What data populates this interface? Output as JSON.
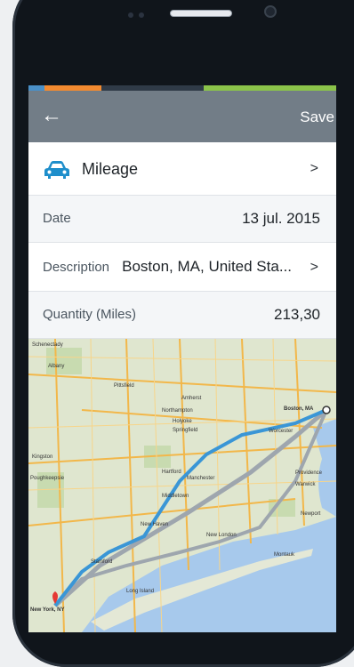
{
  "appbar": {
    "back_icon": "arrow-left-icon",
    "save_label": "Save"
  },
  "rows": {
    "category": {
      "icon": "car-icon",
      "label": "Mileage"
    },
    "date": {
      "label": "Date",
      "value": "13 jul. 2015"
    },
    "description": {
      "label": "Description",
      "value": "Boston, MA, United Sta..."
    },
    "quantity": {
      "label": "Quantity (Miles)",
      "value": "213,30"
    }
  },
  "map": {
    "places": [
      "Schenectady",
      "Albany",
      "Pittsfield",
      "Amherst",
      "Northampton",
      "Holyoke",
      "Springfield",
      "Hartford",
      "Manchester",
      "Middletown",
      "Kingston",
      "Poughkeepsie",
      "New Haven",
      "Stamford",
      "New London",
      "Worcester",
      "Boston, MA",
      "Providence",
      "Warwick",
      "Newport",
      "Montauk",
      "Long Island",
      "New York, NY"
    ]
  },
  "colors": {
    "appbar": "#727d87",
    "accent": "#1e8ecb",
    "route": "#3a96d6"
  }
}
